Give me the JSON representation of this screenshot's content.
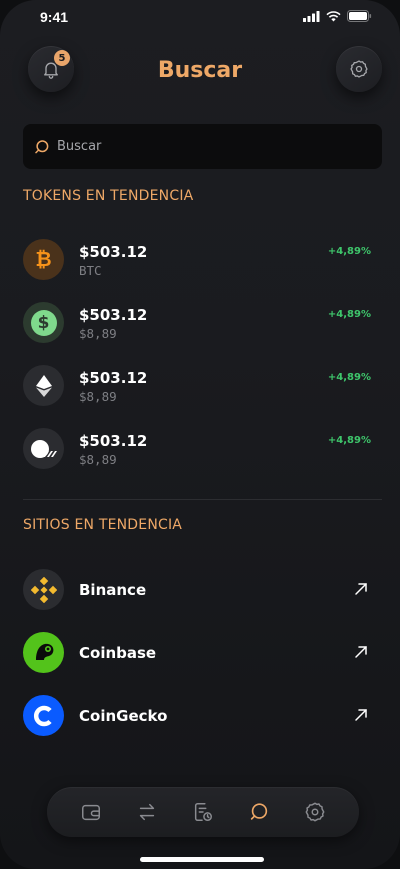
{
  "status_bar": {
    "time": "9:41"
  },
  "header": {
    "title": "Buscar",
    "notification_count": "5"
  },
  "search": {
    "placeholder": "Buscar"
  },
  "trending_tokens": {
    "title": "TOKENS EN TENDENCIA",
    "items": [
      {
        "icon": "bitcoin-icon",
        "price": "$503.12",
        "subtitle": "BTC",
        "change": "+4,89%",
        "color": "#4a321b",
        "glyph_color": "#f7931a"
      },
      {
        "icon": "dollar-icon",
        "price": "$503.12",
        "subtitle": "$8,89",
        "change": "+4,89%",
        "color": "#2c3b2f",
        "glyph_color": "#7fd98c"
      },
      {
        "icon": "ethereum-icon",
        "price": "$503.12",
        "subtitle": "$8,89",
        "change": "+4,89%",
        "color": "#2b2c30",
        "glyph_color": "#ffffff"
      },
      {
        "icon": "coin-icon",
        "price": "$503.12",
        "subtitle": "$8,89",
        "change": "+4,89%",
        "color": "#2b2c30",
        "glyph_color": "#ffffff"
      }
    ]
  },
  "trending_sites": {
    "title": "SITIOS EN TENDENCIA",
    "items": [
      {
        "icon": "binance-icon",
        "name": "Binance"
      },
      {
        "icon": "coinbase-icon",
        "name": "Coinbase"
      },
      {
        "icon": "coingecko-icon",
        "name": "CoinGecko"
      }
    ]
  },
  "nav": {
    "items": [
      "wallet-icon",
      "swap-icon",
      "history-icon",
      "search-chat-icon",
      "settings-icon"
    ],
    "active": "search-chat-icon"
  },
  "colors": {
    "accent": "#eea867",
    "positive": "#3ec56b",
    "background": "#1a1b1f"
  }
}
